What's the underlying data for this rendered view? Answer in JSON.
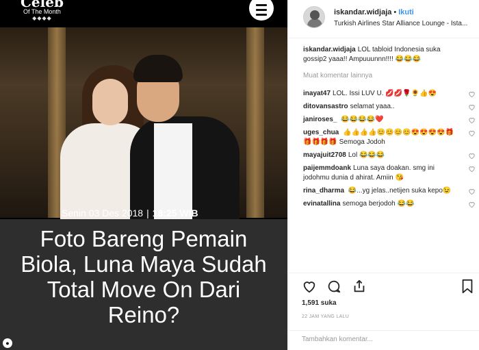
{
  "media": {
    "brand_title": "Celeb",
    "brand_sub": "Of The Month",
    "brand_ornament": "◆◆◆◆",
    "date": "Senin 03 Des 2018",
    "separator": "|",
    "time": "18:25 WIB",
    "headline": "Foto Bareng Pemain Biola, Luna Maya Sudah Total Move On Dari Reino?"
  },
  "header": {
    "username": "iskandar.widjaja",
    "dot": "•",
    "follow_label": "Ikuti",
    "location": "Turkish Airlines Star Alliance Lounge - Ista..."
  },
  "caption": {
    "username": "iskandar.widjaja",
    "text": "LOL tabloid Indonesia suka gossip2 yaaa!! Ampuuunnn!!!!",
    "emoji": "😂😂😂"
  },
  "load_more": "Muat komentar lainnya",
  "comments": [
    {
      "username": "inayat47",
      "text": "LOL. Issi LUV U.",
      "emoji": "💋💋🌹🌻👍😍"
    },
    {
      "username": "ditovansastro",
      "text": "selamat yaaa..",
      "emoji": ""
    },
    {
      "username": "janiroses_",
      "text": "",
      "emoji": "😂😂😂😂❤️"
    },
    {
      "username": "uges_chua",
      "text": "",
      "emoji": "👍👍👍👍😊😊😊😊😍😍😍😍🎁🎁🎁🎁🎁",
      "text2": "Semoga Jodoh"
    },
    {
      "username": "mayajuit2708",
      "text": "Lol",
      "emoji": "😂😂😂"
    },
    {
      "username": "paijemmdoank",
      "text": "Luna saya doakan. smg ini jodohmu dunia d ahirat. Amiin",
      "emoji": "😘"
    },
    {
      "username": "rina_dharma",
      "text": "...yg jelas..netijen suka kepo",
      "emoji_pre": "😂",
      "emoji": "😉"
    },
    {
      "username": "evinatallina",
      "text": "semoga berjodoh",
      "emoji": "😂😂"
    }
  ],
  "actions": {
    "likes": "1,591 suka",
    "time_ago": "22 JAM YANG LALU",
    "comment_placeholder": "Tambahkan komentar..."
  },
  "colors": {
    "accent": "#3897f0",
    "headline_bg": "#2e2e2e"
  }
}
